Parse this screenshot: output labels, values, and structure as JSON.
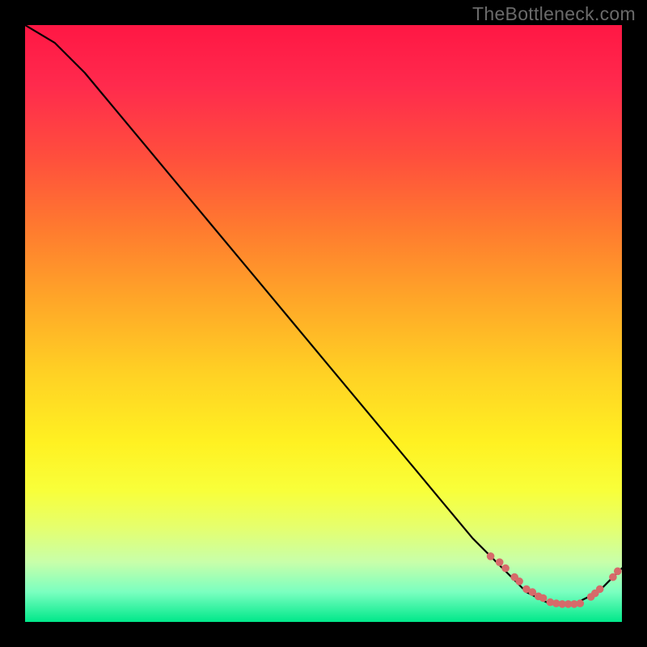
{
  "watermark": "TheBottleneck.com",
  "chart_data": {
    "type": "line",
    "title": "",
    "xlabel": "",
    "ylabel": "",
    "xlim": [
      0,
      100
    ],
    "ylim": [
      0,
      100
    ],
    "grid": false,
    "series": [
      {
        "name": "bottleneck-curve",
        "x": [
          0,
          5,
          10,
          15,
          20,
          25,
          30,
          35,
          40,
          45,
          50,
          55,
          60,
          65,
          70,
          75,
          80,
          82,
          84,
          86,
          88,
          90,
          92,
          94,
          96,
          98,
          100
        ],
        "y": [
          100,
          97,
          92,
          86,
          80,
          74,
          68,
          62,
          56,
          50,
          44,
          38,
          32,
          26,
          20,
          14,
          9,
          7,
          5,
          4,
          3,
          3,
          3,
          4,
          5,
          7,
          9
        ]
      }
    ],
    "points": {
      "name": "highlighted-points",
      "x": [
        78,
        79.5,
        80.5,
        82,
        82.8,
        84,
        85,
        86,
        86.8,
        88,
        89,
        90,
        91,
        92,
        93,
        94.8,
        95.5,
        96.3,
        98.5,
        99.3
      ],
      "y": [
        11,
        10,
        9,
        7.5,
        6.8,
        5.5,
        5,
        4.3,
        4,
        3.3,
        3.1,
        3,
        3,
        3,
        3.1,
        4.2,
        4.8,
        5.5,
        7.5,
        8.5
      ]
    },
    "colors": {
      "curve": "#000000",
      "points": "#d66a6a",
      "gradient_top": "#ff1744",
      "gradient_mid": "#fff122",
      "gradient_bottom": "#00e88a"
    }
  }
}
